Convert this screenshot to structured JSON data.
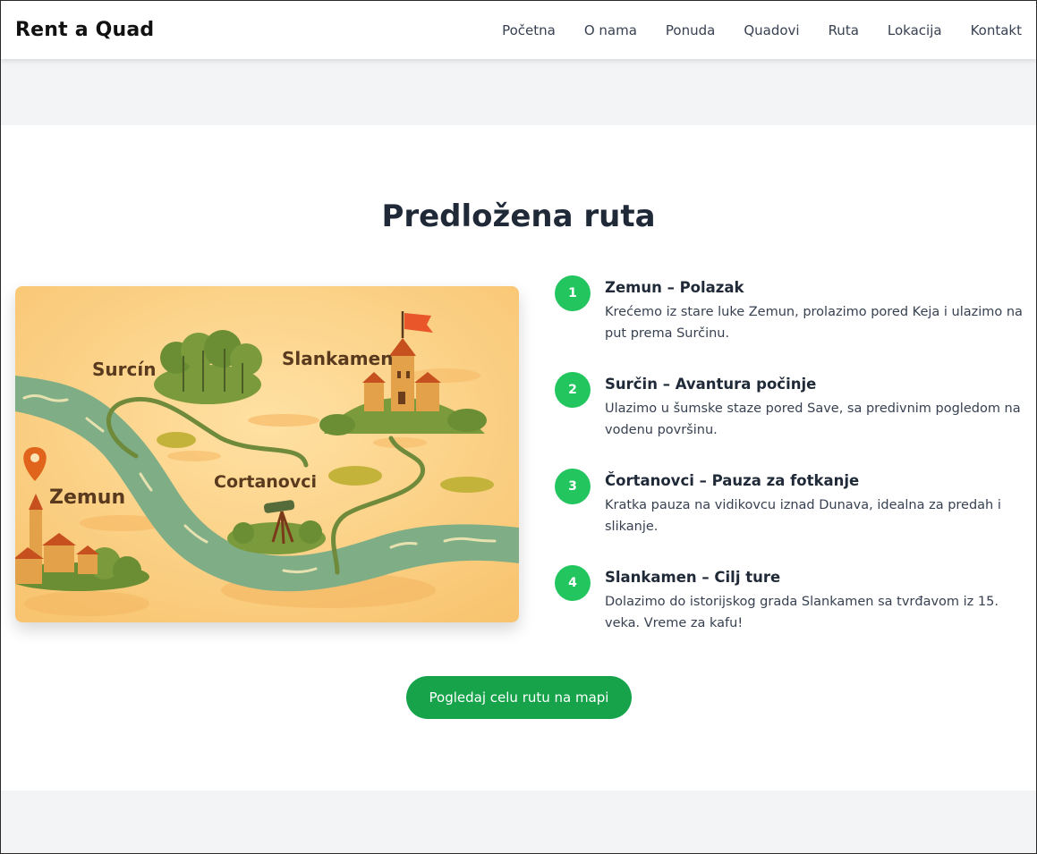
{
  "header": {
    "logo": "Rent a Quad",
    "nav": [
      "Početna",
      "O nama",
      "Ponuda",
      "Quadovi",
      "Ruta",
      "Lokacija",
      "Kontakt"
    ]
  },
  "route": {
    "title": "Predložena ruta",
    "map_labels": {
      "surcin": "Surcín",
      "slankamen": "Slankamen",
      "cortanovci": "Cortanovci",
      "zemun": "Zemun"
    },
    "steps": [
      {
        "num": "1",
        "title": "Zemun – Polazak",
        "desc": "Krećemo iz stare luke Zemun, prolazimo pored Keja i ulazimo na put prema Surčinu."
      },
      {
        "num": "2",
        "title": "Surčin – Avantura počinje",
        "desc": "Ulazimo u šumske staze pored Save, sa predivnim pogledom na vodenu površinu."
      },
      {
        "num": "3",
        "title": "Čortanovci – Pauza za fotkanje",
        "desc": "Kratka pauza na vidikovcu iznad Dunava, idealna za predah i slikanje."
      },
      {
        "num": "4",
        "title": "Slankamen – Cilj ture",
        "desc": "Dolazimo do istorijskog grada Slankamen sa tvrđavom iz 15. veka. Vreme za kafu!"
      }
    ],
    "cta": "Pogledaj celu rutu na mapi"
  },
  "colors": {
    "accent": "#22c55e",
    "button": "#16a34a",
    "map_bg": "#fcd58c",
    "river": "#7fae86"
  }
}
